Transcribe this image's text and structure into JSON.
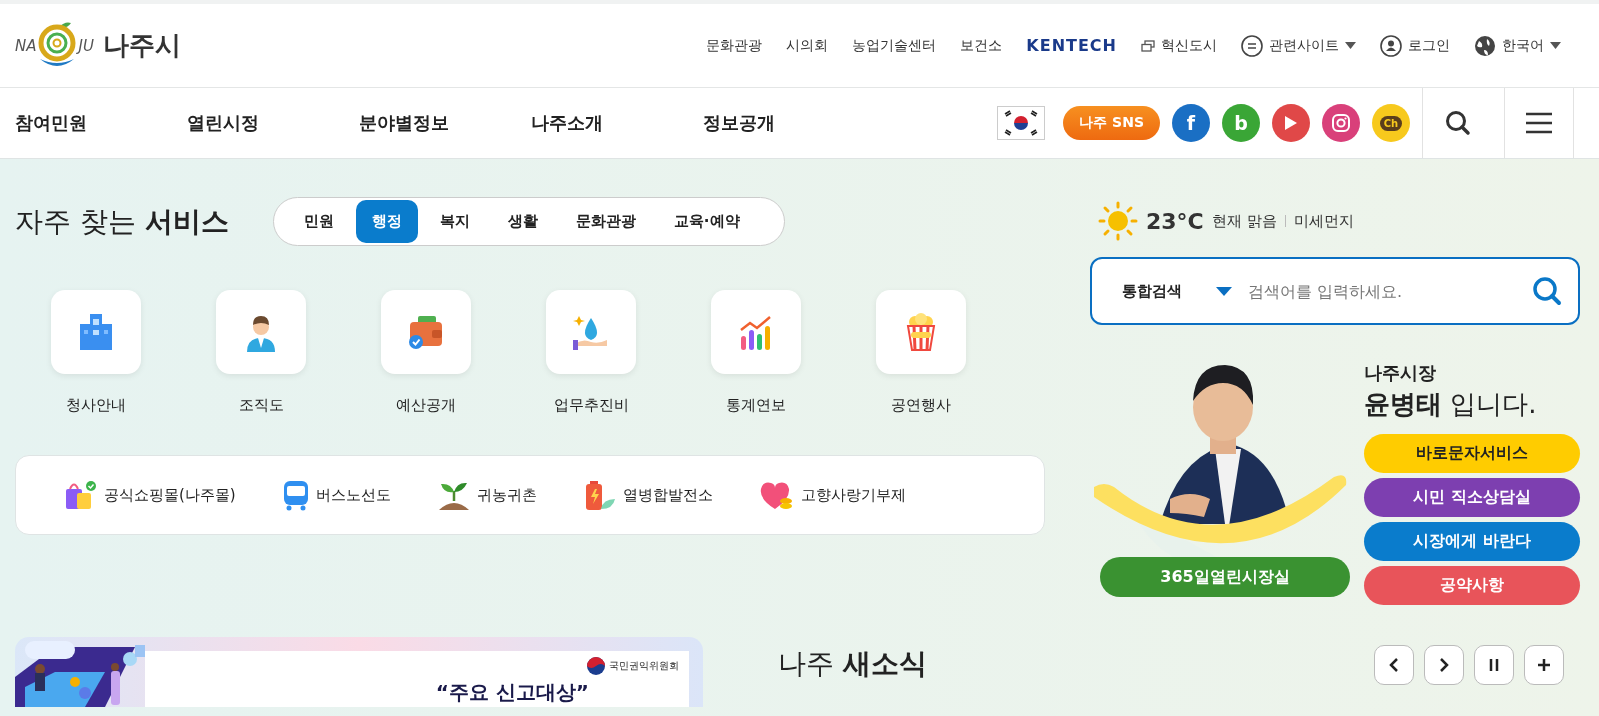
{
  "header": {
    "logo": {
      "left": "NA",
      "right": "JU",
      "name": "나주시"
    },
    "util_links": [
      {
        "kind": "text",
        "label": "문화관광"
      },
      {
        "kind": "text",
        "label": "시의회"
      },
      {
        "kind": "text",
        "label": "농업기술센터"
      },
      {
        "kind": "text",
        "label": "보건소"
      },
      {
        "kind": "brand",
        "label": "KENTECH"
      },
      {
        "kind": "window",
        "label": "혁신도시"
      },
      {
        "kind": "list-dropdown",
        "label": "관련사이트"
      },
      {
        "kind": "user",
        "label": "로그인"
      },
      {
        "kind": "globe-dropdown",
        "label": "한국어"
      }
    ]
  },
  "nav": {
    "items": [
      "참여민원",
      "열린시정",
      "분야별정보",
      "나주소개",
      "정보공개"
    ],
    "sns_label": "나주 SNS",
    "social": [
      {
        "kind": "letter",
        "label": "f",
        "color": "#1a6fc4"
      },
      {
        "kind": "letter",
        "label": "b",
        "color": "#3aa636"
      },
      {
        "kind": "play",
        "color": "#e04848"
      },
      {
        "kind": "camera",
        "color": "#d9407a"
      },
      {
        "kind": "bubble",
        "label": "Ch",
        "color": "#f7c91d"
      }
    ]
  },
  "services": {
    "title": "자주 찾는 **서비스**",
    "tabs": [
      {
        "label": "민원",
        "selected": false
      },
      {
        "label": "행정",
        "selected": true
      },
      {
        "label": "복지",
        "selected": false
      },
      {
        "label": "생활",
        "selected": false
      },
      {
        "label": "문화관광",
        "selected": false
      },
      {
        "label": "교육·예약",
        "selected": false
      }
    ],
    "items": [
      "청사안내",
      "조직도",
      "예산공개",
      "업무추진비",
      "통계연보",
      "공연행사"
    ],
    "quick_links": [
      "공식쇼핑몰(나주몰)",
      "버스노선도",
      "귀농귀촌",
      "열병합발전소",
      "고향사랑기부제"
    ]
  },
  "weather": {
    "temperature": "23°C",
    "condition": "현재 맑음",
    "dust_label": "미세먼지"
  },
  "search": {
    "scope": "통합검색",
    "placeholder": "검색어를 입력하세요."
  },
  "mayor": {
    "title": "나주시장",
    "name": "**윤병태** 입니다.",
    "buttons": [
      {
        "label": "바로문자서비스",
        "color": "#ffcc00"
      },
      {
        "label": "시민 직소상담실",
        "color": "#7d3fb0"
      },
      {
        "label": "시장에게 바란다",
        "color": "#0a7ccc"
      },
      {
        "label": "공약사항",
        "color": "#e8545a"
      }
    ],
    "office_button": "365일열린시장실"
  },
  "banner": {
    "org": "국민권익위원회",
    "headline": "“주요 신고대상”"
  },
  "news": {
    "title": "나주 **새소식**"
  }
}
